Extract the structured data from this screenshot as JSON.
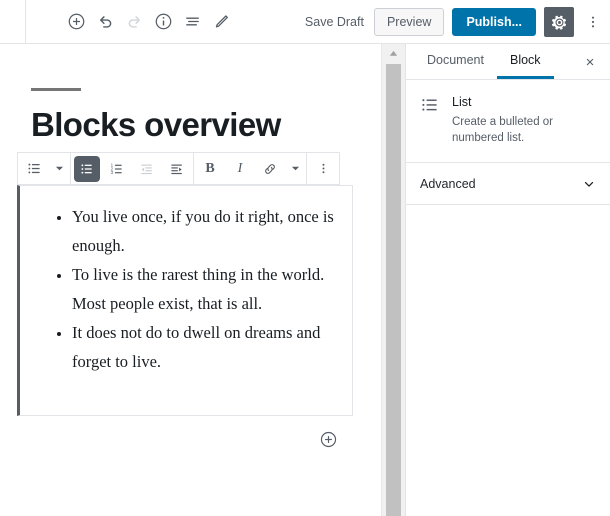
{
  "topbar": {
    "left_tools": [
      {
        "name": "add-block-icon",
        "label": "Add block",
        "disabled": false
      },
      {
        "name": "undo-icon",
        "label": "Undo",
        "disabled": false
      },
      {
        "name": "redo-icon",
        "label": "Redo",
        "disabled": true
      },
      {
        "name": "info-icon",
        "label": "Content structure",
        "disabled": false
      },
      {
        "name": "block-navigation-icon",
        "label": "Block navigation",
        "disabled": false
      },
      {
        "name": "edit-pencil-icon",
        "label": "Edit",
        "disabled": false
      }
    ],
    "save_draft_label": "Save Draft",
    "preview_label": "Preview",
    "publish_label": "Publish...",
    "settings_icon": "gear-icon",
    "more_menu_icon": "vertical-ellipsis-icon",
    "publish_color": "#0073aa",
    "gear_bg_color": "#555d66"
  },
  "editor": {
    "post_title": "Blocks overview",
    "block_toolbar": {
      "items": [
        {
          "name": "block-type-list-icon",
          "label": "Change block type",
          "state": "normal",
          "has_caret": true
        },
        {
          "name": "unordered-list-icon",
          "label": "Convert to unordered list",
          "state": "active",
          "has_caret": false
        },
        {
          "name": "ordered-list-icon",
          "label": "Convert to ordered list",
          "state": "normal",
          "has_caret": false
        },
        {
          "name": "outdent-list-icon",
          "label": "Outdent list item",
          "state": "disabled",
          "has_caret": false
        },
        {
          "name": "indent-list-icon",
          "label": "Indent list item",
          "state": "normal",
          "has_caret": false
        },
        {
          "name": "bold-icon",
          "label": "B",
          "state": "normal",
          "has_caret": false
        },
        {
          "name": "italic-icon",
          "label": "I",
          "state": "normal",
          "has_caret": false
        },
        {
          "name": "link-icon",
          "label": "Link",
          "state": "normal",
          "has_caret": false
        },
        {
          "name": "more-rich-text-icon",
          "label": "More rich text controls",
          "state": "normal",
          "has_caret": true
        },
        {
          "name": "block-options-ellipsis-icon",
          "label": "More options",
          "state": "normal",
          "has_caret": false
        }
      ]
    },
    "list_block": {
      "type": "unordered",
      "selected": true,
      "items": [
        "You live once, if you do it right, once is enough.",
        "To live is the rarest thing in the world. Most people exist, that is all.",
        "It does not do to dwell on dreams and forget to live."
      ]
    },
    "add_block_inserter_label": "Add block"
  },
  "scrollbar": {
    "up_arrow_icon": "scroll-up-arrow-icon",
    "thumb_color": "#c1c1c1",
    "track_color": "#f1f1f1"
  },
  "sidebar": {
    "tabs": [
      {
        "label": "Document",
        "active": false
      },
      {
        "label": "Block",
        "active": true
      }
    ],
    "close_label": "×",
    "block_card": {
      "icon": "list-block-icon",
      "title": "List",
      "description": "Create a bulleted or numbered list."
    },
    "panels": [
      {
        "label": "Advanced",
        "expanded": false,
        "chevron": "chevron-down-icon"
      }
    ],
    "active_tab_color": "#0073aa"
  }
}
